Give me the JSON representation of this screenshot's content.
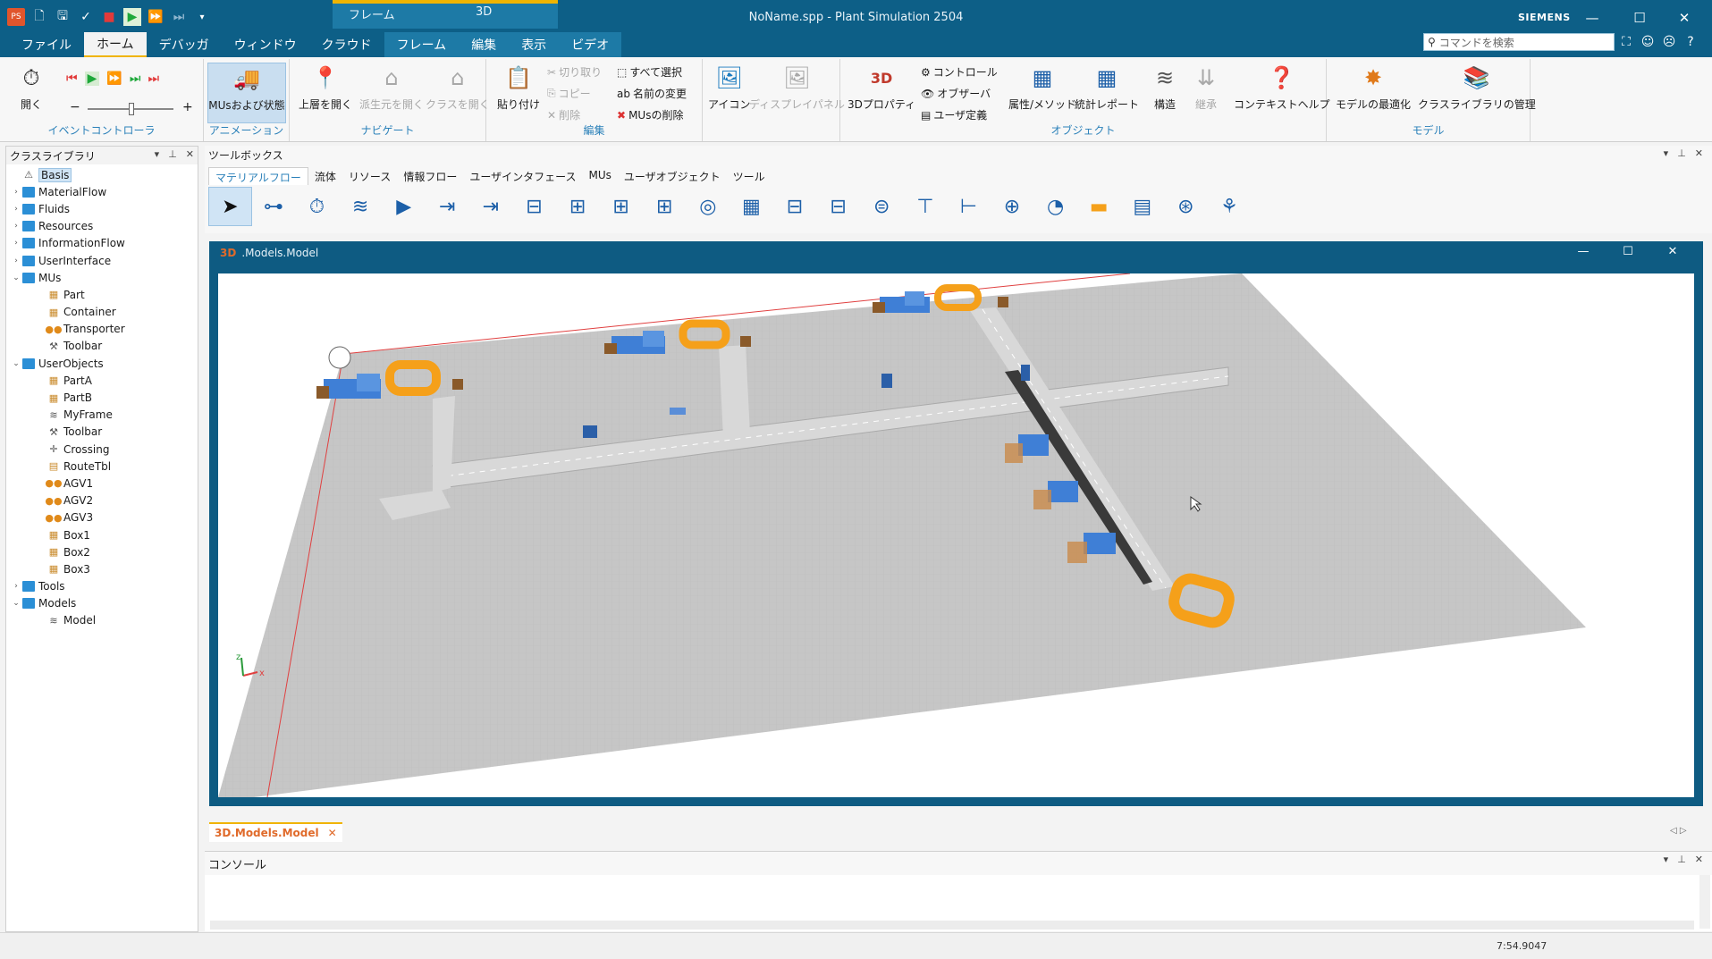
{
  "app": {
    "window_title": "NoName.spp - Plant Simulation 2504",
    "brand": "SIEMENS"
  },
  "context_tabs": [
    "フレーム",
    "3D"
  ],
  "menu": [
    "ファイル",
    "ホーム",
    "デバッガ",
    "ウィンドウ",
    "クラウド",
    "フレーム",
    "編集",
    "表示",
    "ビデオ"
  ],
  "search": {
    "placeholder": "コマンドを検索"
  },
  "ribbon": {
    "groups": {
      "event_controller": "イベントコントローラ",
      "animation": "アニメーション",
      "navigate": "ナビゲート",
      "edit": "編集",
      "object": "オブジェクト",
      "model": "モデル"
    },
    "open": "開く",
    "mus_state": "MUsおよび状態",
    "open_parent": "上層を開く",
    "open_origin": "派生元を開く",
    "open_class": "クラスを開く",
    "paste": "貼り付け",
    "cut": "切り取り",
    "copy": "コピー",
    "delete": "削除",
    "select_all": "すべて選択",
    "rename": "名前の変更",
    "delete_mus": "MUsの削除",
    "icon": "アイコン",
    "display_panel": "ディスプレイパネル",
    "props3d": "3Dプロパティ",
    "control": "コントロール",
    "observer": "オブザーバ",
    "user_def": "ユーザ定義",
    "attr_methods": "属性/メソッド",
    "stats_report": "統計レポート",
    "structure": "構造",
    "inherit": "継承",
    "context_help": "コンテキストヘルプ",
    "optimize": "モデルの最適化",
    "manage_libs": "クラスライブラリの管理"
  },
  "class_library": {
    "title": "クラスライブラリ",
    "items": [
      {
        "label": "Basis",
        "depth": 0,
        "twisty": "",
        "icon": "basis-icon"
      },
      {
        "label": "MaterialFlow",
        "depth": 0,
        "twisty": "›",
        "icon": "folder-icon"
      },
      {
        "label": "Fluids",
        "depth": 0,
        "twisty": "›",
        "icon": "folder-icon"
      },
      {
        "label": "Resources",
        "depth": 0,
        "twisty": "›",
        "icon": "folder-icon"
      },
      {
        "label": "InformationFlow",
        "depth": 0,
        "twisty": "›",
        "icon": "folder-icon"
      },
      {
        "label": "UserInterface",
        "depth": 0,
        "twisty": "›",
        "icon": "folder-icon"
      },
      {
        "label": "MUs",
        "depth": 0,
        "twisty": "⌄",
        "icon": "folder-icon"
      },
      {
        "label": "Part",
        "depth": 1,
        "twisty": "",
        "icon": "part-icon"
      },
      {
        "label": "Container",
        "depth": 1,
        "twisty": "",
        "icon": "container-icon"
      },
      {
        "label": "Transporter",
        "depth": 1,
        "twisty": "",
        "icon": "transporter-icon"
      },
      {
        "label": "Toolbar",
        "depth": 1,
        "twisty": "",
        "icon": "toolbar-icon"
      },
      {
        "label": "UserObjects",
        "depth": 0,
        "twisty": "⌄",
        "icon": "folder-icon"
      },
      {
        "label": "PartA",
        "depth": 1,
        "twisty": "",
        "icon": "part-icon"
      },
      {
        "label": "PartB",
        "depth": 1,
        "twisty": "",
        "icon": "part-icon"
      },
      {
        "label": "MyFrame",
        "depth": 1,
        "twisty": "",
        "icon": "frame-icon"
      },
      {
        "label": "Toolbar",
        "depth": 1,
        "twisty": "",
        "icon": "toolbar-icon"
      },
      {
        "label": "Crossing",
        "depth": 1,
        "twisty": "",
        "icon": "crossing-icon"
      },
      {
        "label": "RouteTbl",
        "depth": 1,
        "twisty": "",
        "icon": "table-icon"
      },
      {
        "label": "AGV1",
        "depth": 1,
        "twisty": "",
        "icon": "transporter-icon"
      },
      {
        "label": "AGV2",
        "depth": 1,
        "twisty": "",
        "icon": "transporter-icon"
      },
      {
        "label": "AGV3",
        "depth": 1,
        "twisty": "",
        "icon": "transporter-icon"
      },
      {
        "label": "Box1",
        "depth": 1,
        "twisty": "",
        "icon": "container-icon"
      },
      {
        "label": "Box2",
        "depth": 1,
        "twisty": "",
        "icon": "container-icon"
      },
      {
        "label": "Box3",
        "depth": 1,
        "twisty": "",
        "icon": "container-icon"
      },
      {
        "label": "Tools",
        "depth": 0,
        "twisty": "›",
        "icon": "folder-icon"
      },
      {
        "label": "Models",
        "depth": 0,
        "twisty": "⌄",
        "icon": "folder-icon"
      },
      {
        "label": "Model",
        "depth": 1,
        "twisty": "",
        "icon": "frame-icon"
      }
    ]
  },
  "toolbox": {
    "title": "ツールボックス",
    "tabs": [
      "マテリアルフロー",
      "流体",
      "リソース",
      "情報フロー",
      "ユーザインタフェース",
      "MUs",
      "ユーザオブジェクト",
      "ツール"
    ],
    "icons": [
      "pointer-icon",
      "connector-icon",
      "eventcontroller-icon",
      "frame-icon",
      "source-icon",
      "entrance-icon",
      "drain-icon",
      "singleproc-icon",
      "parallelproc-icon",
      "assembly-icon",
      "dismantle-icon",
      "shift-icon",
      "store-icon",
      "buffer-icon",
      "placebuffer-icon",
      "line-icon",
      "track-icon",
      "turntable-icon",
      "crossing-icon",
      "turnplate-icon",
      "twolane-icon",
      "sorter-icon",
      "cycle-icon",
      "tree-icon"
    ]
  },
  "window3d": {
    "tag": "3D",
    "title": ".Models.Model",
    "axis_x": "x",
    "axis_z": "z"
  },
  "doc_tab": {
    "tag": "3D",
    "name": ".Models.Model"
  },
  "console": {
    "title": "コンソール"
  },
  "status": {
    "time": "7:54.9047"
  },
  "colors": {
    "titlebar": "#0d5f87",
    "accent": "#f0b400",
    "agv_track": "#f5a01a",
    "floor": "#c9c9c9"
  }
}
